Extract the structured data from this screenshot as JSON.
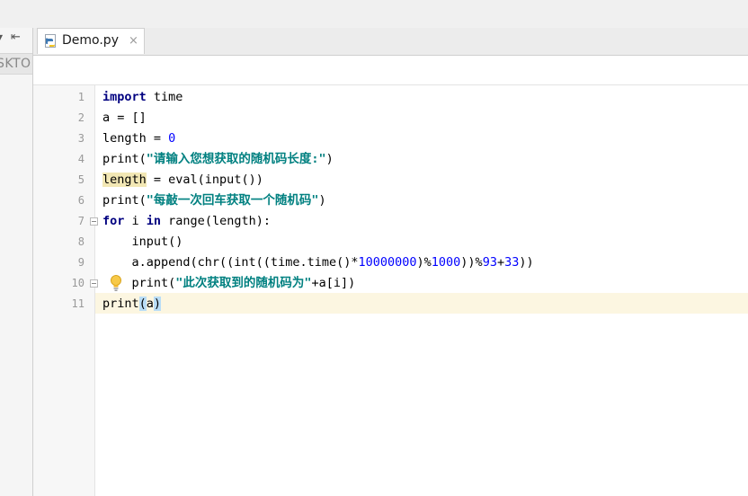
{
  "left_panel": {
    "project_label": "SKTO"
  },
  "tabs": [
    {
      "label": "Demo.py",
      "close": "×"
    }
  ],
  "editor": {
    "lines": [
      {
        "num": "1"
      },
      {
        "num": "2"
      },
      {
        "num": "3"
      },
      {
        "num": "4"
      },
      {
        "num": "5"
      },
      {
        "num": "6"
      },
      {
        "num": "7"
      },
      {
        "num": "8"
      },
      {
        "num": "9"
      },
      {
        "num": "10"
      },
      {
        "num": "11"
      }
    ],
    "tokens": {
      "l1_kw": "import",
      "l1_rest": " time",
      "l2": "a = []",
      "l3_a": "length = ",
      "l3_num": "0",
      "l4_a": "print(",
      "l4_str": "\"请输入您想获取的随机码长度:\"",
      "l4_b": ")",
      "l5_hl": "length",
      "l5_rest": " = eval(input())",
      "l6_a": "print(",
      "l6_str": "\"每敲一次回车获取一个随机码\"",
      "l6_b": ")",
      "l7_kw1": "for",
      "l7_a": " i ",
      "l7_kw2": "in",
      "l7_b": " range(length):",
      "l8": "    input()",
      "l9_a": "    a.append(chr((int((time.time()*",
      "l9_num1": "10000000",
      "l9_b": ")%",
      "l9_num2": "1000",
      "l9_c": "))%",
      "l9_num3": "93",
      "l9_d": "+",
      "l9_num4": "33",
      "l9_e": "))",
      "l10_a": "    print(",
      "l10_str": "\"此次获取到的随机码为\"",
      "l10_b": "+a[i])",
      "l11_a": "print",
      "l11_br1": "(",
      "l11_b": "a",
      "l11_br2": ")"
    }
  },
  "icons": {
    "tab_icon": "python-file-icon",
    "fold_icon": "fold-marker-icon",
    "intention_icon": "lightbulb-icon"
  },
  "colors": {
    "keyword": "#000080",
    "string": "#008080",
    "number": "#0000ff",
    "caret_row": "#fcf6e1",
    "usage_highlight": "#f2e7b4",
    "brace_highlight": "#b9ddf6"
  }
}
